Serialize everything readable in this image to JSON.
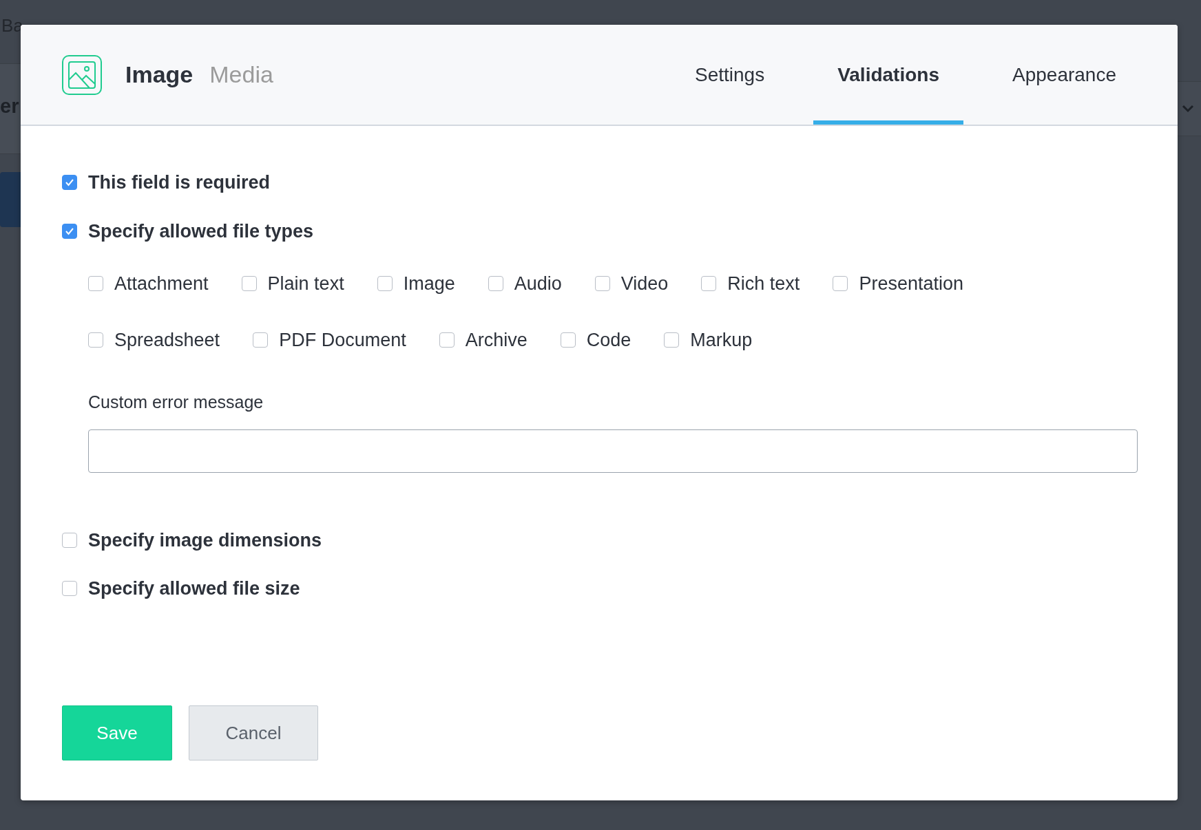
{
  "background": {
    "page_title": "Ba",
    "heading": "er"
  },
  "header": {
    "title": "Image",
    "subtitle": "Media"
  },
  "tabs": [
    {
      "label": "Settings",
      "selected": false
    },
    {
      "label": "Validations",
      "selected": true
    },
    {
      "label": "Appearance",
      "selected": false
    }
  ],
  "validations": [
    {
      "label": "This field is required",
      "checked": true
    },
    {
      "label": "Specify allowed file types",
      "checked": true,
      "file_types": [
        {
          "label": "Attachment",
          "checked": false
        },
        {
          "label": "Plain text",
          "checked": false
        },
        {
          "label": "Image",
          "checked": false
        },
        {
          "label": "Audio",
          "checked": false
        },
        {
          "label": "Video",
          "checked": false
        },
        {
          "label": "Rich text",
          "checked": false
        },
        {
          "label": "Presentation",
          "checked": false
        },
        {
          "label": "Spreadsheet",
          "checked": false
        },
        {
          "label": "PDF Document",
          "checked": false
        },
        {
          "label": "Archive",
          "checked": false
        },
        {
          "label": "Code",
          "checked": false
        },
        {
          "label": "Markup",
          "checked": false
        }
      ],
      "error_message": {
        "label": "Custom error message"
      }
    },
    {
      "label": "Specify image dimensions",
      "checked": false
    },
    {
      "label": "Specify allowed file size",
      "checked": false
    }
  ],
  "buttons": [
    {
      "label": "Save",
      "kind": "primary"
    },
    {
      "label": "Cancel",
      "kind": "secondary"
    }
  ]
}
